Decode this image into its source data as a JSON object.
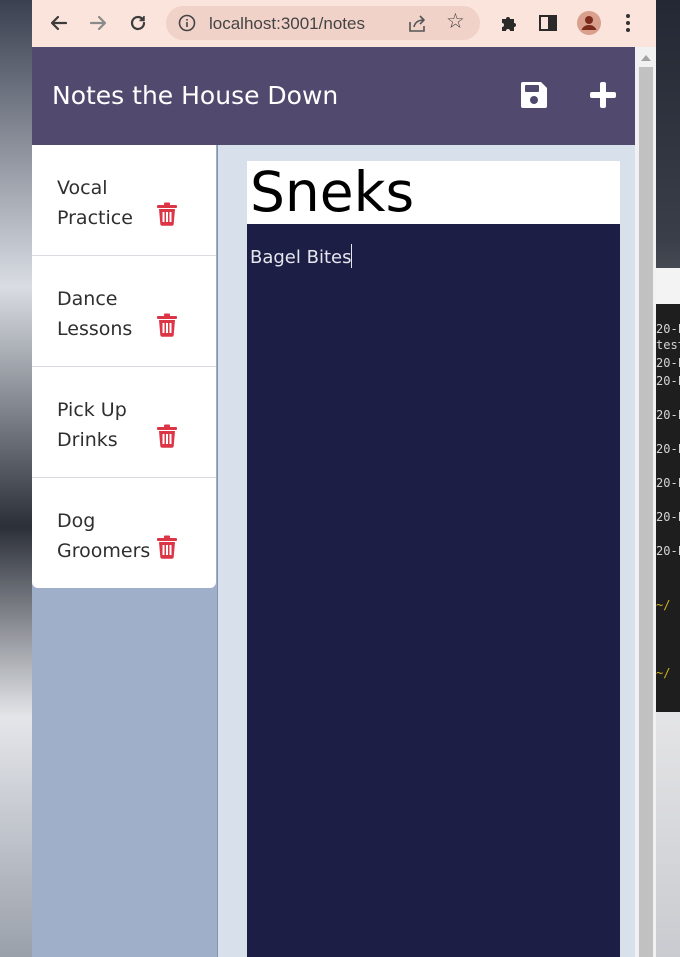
{
  "browser": {
    "url": "localhost:3001/notes",
    "icons": [
      "back-arrow-icon",
      "forward-arrow-icon",
      "reload-icon",
      "info-icon",
      "share-icon",
      "star-icon",
      "extensions-puzzle-icon",
      "side-panel-icon",
      "profile-avatar-icon",
      "menu-dots-icon"
    ]
  },
  "navbar": {
    "brand": "Notes the House Down",
    "save_icon": "save-floppy-icon",
    "new_icon": "plus-icon"
  },
  "notes": [
    {
      "title": "Vocal Practice"
    },
    {
      "title": "Dance Lessons"
    },
    {
      "title": "Pick Up Drinks"
    },
    {
      "title": "Dog Groomers"
    }
  ],
  "active_note": {
    "title": "Sneks",
    "text": "Bagel Bites"
  },
  "colors": {
    "navbar": "#514a6e",
    "sidebar": "#a0afc9",
    "editor_bg": "#1c1e45",
    "trash": "#dc3545",
    "toolbar": "#fbe4dc"
  }
}
